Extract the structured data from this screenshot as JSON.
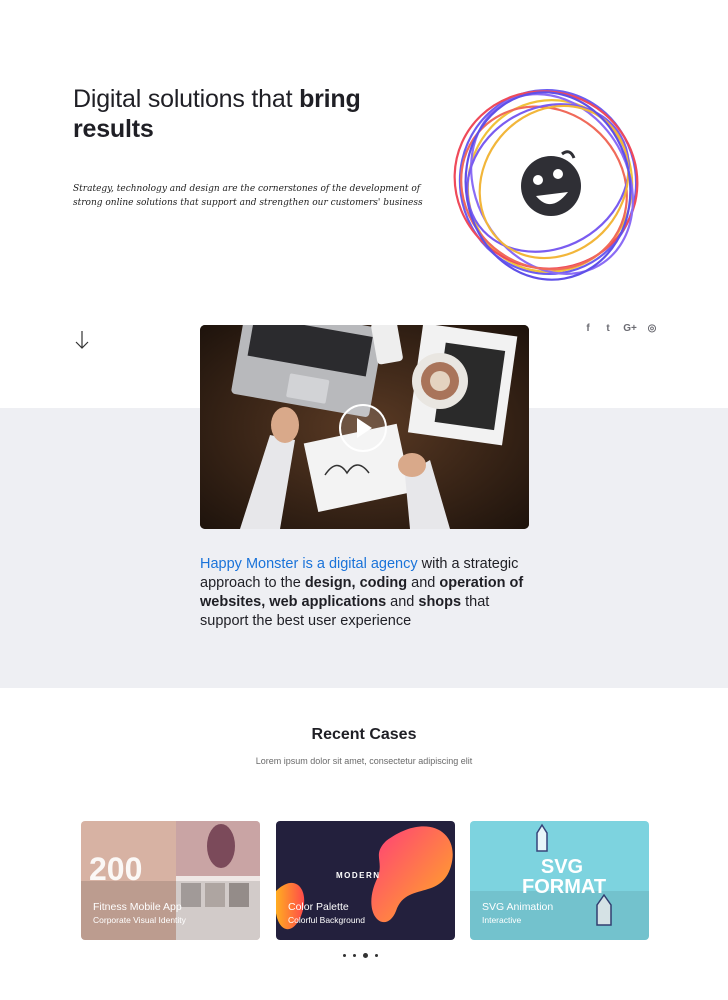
{
  "hero": {
    "title_regular": "Digital solutions that ",
    "title_bold": "bring results",
    "subtitle": "Strategy, technology and design are the cornerstones of the development of strong online solutions that support and strengthen our customers' business"
  },
  "social": {
    "items": [
      {
        "name": "facebook-icon",
        "glyph": "f"
      },
      {
        "name": "twitter-icon",
        "glyph": "t"
      },
      {
        "name": "google-plus-icon",
        "glyph": "G+"
      },
      {
        "name": "dribbble-icon",
        "glyph": "◎"
      }
    ]
  },
  "about": {
    "highlight": "Happy Monster is a digital agency",
    "part1": " with a strategic approach to the ",
    "bold1": "design, coding",
    "part2": " and ",
    "bold2": "operation of websites, web applications",
    "part3": " and ",
    "bold3": "shops",
    "part4": " that support the best user experience"
  },
  "cases": {
    "title": "Recent Cases",
    "subtitle": "Lorem ipsum dolor sit amet, consectetur adipiscing elit",
    "items": [
      {
        "title": "Fitness Mobile App",
        "subtitle": "Corporate Visual Identity",
        "big_number": "200"
      },
      {
        "title": "Color Palette",
        "subtitle": "Colorful Background",
        "art_text": "MODERN"
      },
      {
        "title": "SVG Animation",
        "subtitle": "Interactive",
        "art_text": "SVG FORMAT"
      }
    ],
    "pagination": {
      "count": 4,
      "active": 3
    }
  },
  "colors": {
    "accent": "#1a73d9",
    "band": "#eeeff3",
    "text": "#1f1f25"
  }
}
